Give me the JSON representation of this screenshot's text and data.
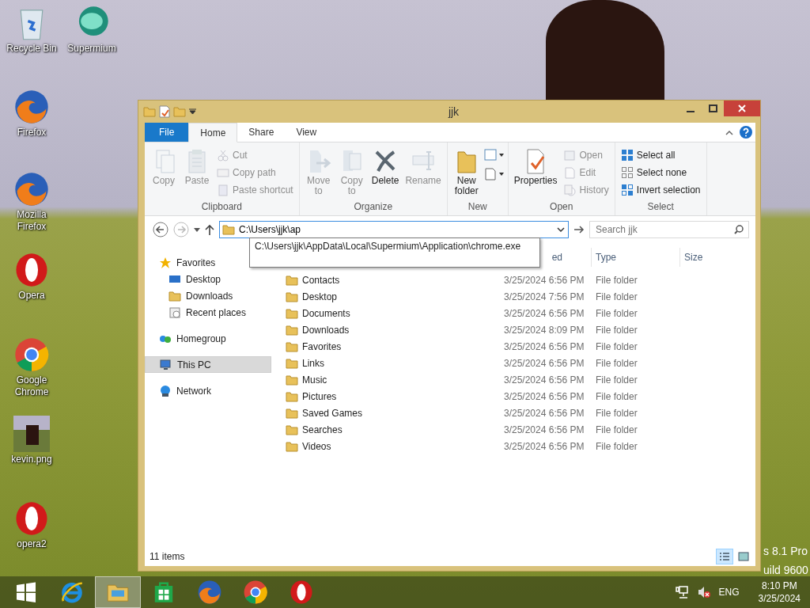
{
  "desktop": {
    "icons": [
      {
        "label": "Recycle Bin",
        "kind": "bin"
      },
      {
        "label": "Supermium",
        "kind": "supermium"
      },
      {
        "label": "Firefox",
        "kind": "firefox"
      },
      {
        "label": "Mozilla Firefox",
        "kind": "firefox"
      },
      {
        "label": "Opera",
        "kind": "opera"
      },
      {
        "label": "Google Chrome",
        "kind": "chrome"
      },
      {
        "label": "kevin.png",
        "kind": "photo"
      },
      {
        "label": "opera2",
        "kind": "opera"
      }
    ],
    "watermark": [
      "s 8.1 Pro",
      "uild 9600"
    ]
  },
  "window": {
    "title": "jjk",
    "tabs": [
      {
        "label": "File",
        "kind": "file",
        "selected": false
      },
      {
        "label": "Home",
        "kind": "tab",
        "selected": true
      },
      {
        "label": "Share",
        "kind": "tab",
        "selected": false
      },
      {
        "label": "View",
        "kind": "tab",
        "selected": false
      }
    ],
    "ribbon": [
      {
        "label": "Clipboard",
        "items": [
          {
            "kind": "large",
            "label": "Copy",
            "disabled": true
          },
          {
            "kind": "large",
            "label": "Paste",
            "disabled": true
          },
          {
            "kind": "small",
            "label": "Cut",
            "disabled": true
          },
          {
            "kind": "small",
            "label": "Copy path",
            "disabled": true
          },
          {
            "kind": "small",
            "label": "Paste shortcut",
            "disabled": true
          }
        ]
      },
      {
        "label": "Organize",
        "items": [
          {
            "kind": "large",
            "label": "Move to",
            "disabled": true
          },
          {
            "kind": "large",
            "label": "Copy to",
            "disabled": true
          },
          {
            "kind": "large",
            "label": "Delete",
            "disabled": false
          },
          {
            "kind": "large",
            "label": "Rename",
            "disabled": true
          }
        ]
      },
      {
        "label": "New",
        "items": [
          {
            "kind": "large",
            "label": "New folder",
            "disabled": false
          }
        ]
      },
      {
        "label": "Open",
        "items": [
          {
            "kind": "large",
            "label": "Properties",
            "disabled": false
          },
          {
            "kind": "small",
            "label": "Open",
            "disabled": true
          },
          {
            "kind": "small",
            "label": "Edit",
            "disabled": true
          },
          {
            "kind": "small",
            "label": "History",
            "disabled": true
          }
        ]
      },
      {
        "label": "Select",
        "items": [
          {
            "kind": "small",
            "label": "Select all",
            "disabled": false
          },
          {
            "kind": "small",
            "label": "Select none",
            "disabled": false
          },
          {
            "kind": "small",
            "label": "Invert selection",
            "disabled": false
          }
        ]
      }
    ],
    "address": {
      "value": "C:\\Users\\jjk\\ap",
      "suggestion": "C:\\Users\\jjk\\AppData\\Local\\Supermium\\Application\\chrome.exe"
    },
    "search": {
      "placeholder": "Search jjk"
    },
    "columns": [
      "ed",
      "Type",
      "Size"
    ],
    "nav": [
      {
        "label": "Favorites",
        "kind": "star",
        "selected": false,
        "children": [
          {
            "label": "Desktop",
            "kind": "desktop",
            "selected": false
          },
          {
            "label": "Downloads",
            "kind": "folder",
            "selected": false
          },
          {
            "label": "Recent places",
            "kind": "recent",
            "selected": false
          }
        ]
      },
      {
        "label": "Homegroup",
        "kind": "homegroup",
        "selected": false
      },
      {
        "label": "This PC",
        "kind": "pc",
        "selected": true
      },
      {
        "label": "Network",
        "kind": "network",
        "selected": false
      }
    ],
    "rows": [
      {
        "name": "Contacts",
        "date": "3/25/2024 6:56 PM",
        "type": "File folder"
      },
      {
        "name": "Desktop",
        "date": "3/25/2024 7:56 PM",
        "type": "File folder"
      },
      {
        "name": "Documents",
        "date": "3/25/2024 6:56 PM",
        "type": "File folder"
      },
      {
        "name": "Downloads",
        "date": "3/25/2024 8:09 PM",
        "type": "File folder"
      },
      {
        "name": "Favorites",
        "date": "3/25/2024 6:56 PM",
        "type": "File folder"
      },
      {
        "name": "Links",
        "date": "3/25/2024 6:56 PM",
        "type": "File folder"
      },
      {
        "name": "Music",
        "date": "3/25/2024 6:56 PM",
        "type": "File folder"
      },
      {
        "name": "Pictures",
        "date": "3/25/2024 6:56 PM",
        "type": "File folder"
      },
      {
        "name": "Saved Games",
        "date": "3/25/2024 6:56 PM",
        "type": "File folder"
      },
      {
        "name": "Searches",
        "date": "3/25/2024 6:56 PM",
        "type": "File folder"
      },
      {
        "name": "Videos",
        "date": "3/25/2024 6:56 PM",
        "type": "File folder"
      }
    ],
    "status": "11 items",
    "views": [
      {
        "kind": "details",
        "selected": true
      },
      {
        "kind": "large-icons",
        "selected": false
      }
    ]
  },
  "taskbar": {
    "apps": [
      {
        "kind": "ie",
        "selected": false
      },
      {
        "kind": "explorer",
        "selected": true
      },
      {
        "kind": "store",
        "selected": false
      },
      {
        "kind": "firefox",
        "selected": false
      },
      {
        "kind": "chrome",
        "selected": false
      },
      {
        "kind": "opera",
        "selected": false
      }
    ],
    "language": "ENG",
    "time": "8:10 PM",
    "date": "3/25/2024"
  }
}
